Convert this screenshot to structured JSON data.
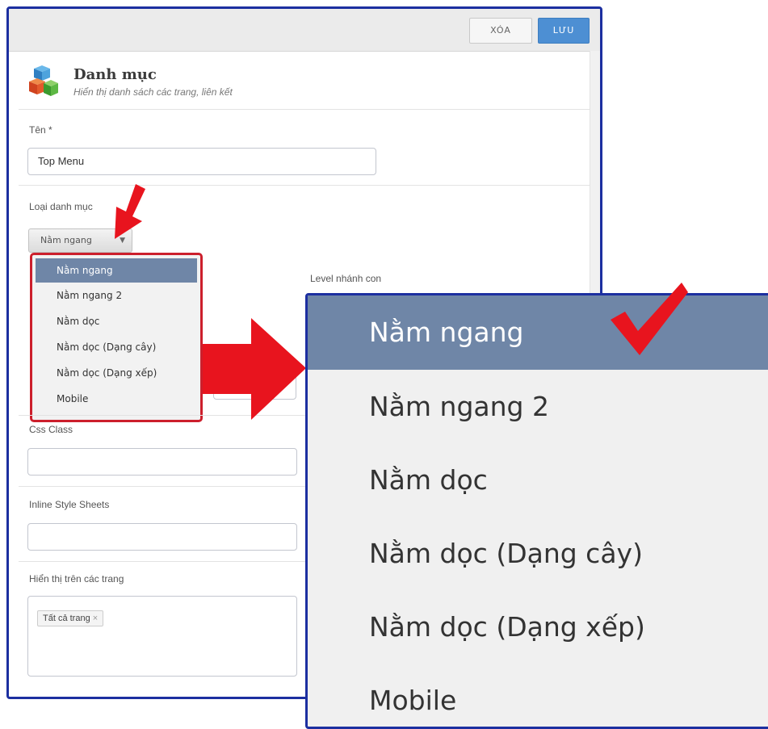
{
  "toolbar": {
    "delete_label": "XÓA",
    "save_label": "LƯU"
  },
  "header": {
    "title": "Danh mục",
    "subtitle": "Hiển thị danh sách các trang, liên kết"
  },
  "form": {
    "name_label": "Tên *",
    "name_value": "Top Menu",
    "type_label": "Loại danh mục",
    "type_selected": "Nằm ngang",
    "type_options": [
      "Nằm ngang",
      "Nằm ngang 2",
      "Nằm dọc",
      "Nằm dọc (Dạng cây)",
      "Nằm dọc (Dạng xếp)",
      "Mobile"
    ],
    "level_label": "Level nhánh con",
    "css_label": "Css Class",
    "css_value": "",
    "inline_label": "Inline Style Sheets",
    "inline_value": "",
    "pages_label": "Hiển thị trên các trang",
    "pages_tag": "Tất cả trang",
    "tag_remove": "×"
  },
  "zoomed_options": [
    "Nằm ngang",
    "Nằm ngang 2",
    "Nằm dọc",
    "Nằm dọc (Dạng cây)",
    "Nằm dọc (Dạng xếp)",
    "Mobile"
  ],
  "colors": {
    "panel_border": "#1c2fa0",
    "highlight": "#cc1f2c",
    "selected": "#6f86a7",
    "save": "#4d8fd3"
  },
  "icons": {
    "logo": "stacked-cubes-icon",
    "chevron": "chevron-down-icon",
    "arrow": "arrow-icon",
    "check": "checkmark-icon"
  }
}
